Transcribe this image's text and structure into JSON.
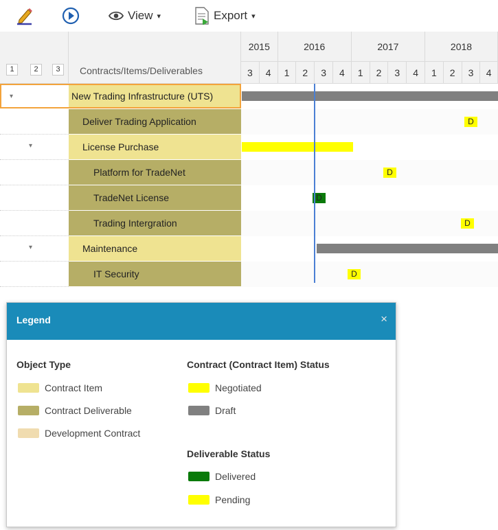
{
  "toolbar": {
    "view_label": "View",
    "export_label": "Export",
    "caret": "▾",
    "icons": [
      "pencil-icon",
      "play-icon",
      "eye-icon",
      "document-icon"
    ]
  },
  "grid": {
    "column_title": "Contracts/Items/Deliverables",
    "levels": [
      "1",
      "2",
      "3"
    ],
    "years": [
      "2015",
      "2016",
      "2017",
      "2018"
    ],
    "quarters": [
      "3",
      "4",
      "1",
      "2",
      "3",
      "4",
      "1",
      "2",
      "3",
      "4",
      "1",
      "2",
      "3",
      "4"
    ],
    "rows": [
      {
        "label": "New Trading Infrastructure (UTS)",
        "expand": "▾"
      },
      {
        "label": "Deliver Trading Application",
        "mark": "D"
      },
      {
        "label": "License Purchase",
        "expand": "▾"
      },
      {
        "label": "Platform for TradeNet",
        "mark": "D"
      },
      {
        "label": "TradeNet License",
        "mark": "D"
      },
      {
        "label": "Trading Intergration",
        "mark": "D"
      },
      {
        "label": "Maintenance",
        "expand": "▾"
      },
      {
        "label": "IT Security",
        "mark": "D"
      }
    ]
  },
  "legend": {
    "title": "Legend",
    "close": "×",
    "object_type": {
      "heading": "Object Type",
      "items": [
        "Contract Item",
        "Contract Deliverable",
        "Development Contract"
      ]
    },
    "contract_status": {
      "heading": "Contract (Contract Item) Status",
      "items": [
        "Negotiated",
        "Draft"
      ]
    },
    "deliverable_status": {
      "heading": "Deliverable Status",
      "items": [
        "Delivered",
        "Pending"
      ]
    }
  },
  "colors": {
    "contract_item": "#efe391",
    "contract_deliverable": "#b6ae66",
    "development_contract": "#f0dcb0",
    "negotiated": "#ffff00",
    "draft": "#808080",
    "delivered": "#0a7a0a",
    "pending": "#ffff00",
    "today_line": "#4a7fd4",
    "legend_header": "#1a8bb9"
  }
}
